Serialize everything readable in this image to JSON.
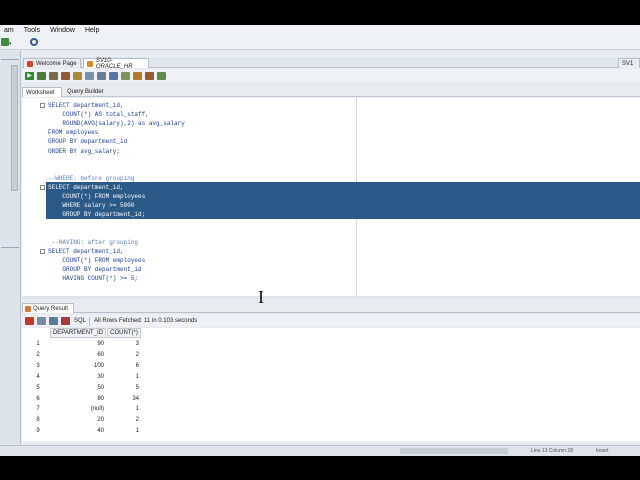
{
  "menu": [
    "am",
    "Tools",
    "Window",
    "Help"
  ],
  "tabs": [
    {
      "label": "Welcome Page",
      "active": false
    },
    {
      "label": "SV10-ORACLE_HR",
      "active": true
    }
  ],
  "right_tab": "SV1",
  "subtabs": [
    "Worksheet",
    "Query Builder"
  ],
  "code_lines": [
    {
      "text": "SELECT department_id,",
      "fold": true
    },
    {
      "text": "    COUNT(*) AS total_staff,",
      "fold": false
    },
    {
      "text": "    ROUND(AVG(salary),2) as avg_salary",
      "fold": false
    },
    {
      "text": "FROM employees",
      "fold": false
    },
    {
      "text": "GROUP BY department_id",
      "fold": false
    },
    {
      "text": "ORDER BY avg_salary;",
      "fold": false
    },
    {
      "text": "",
      "fold": false
    },
    {
      "text": "",
      "fold": false
    },
    {
      "text": "--WHERE: before grouping",
      "fold": false
    },
    {
      "text": "SELECT department_id,",
      "fold": true
    },
    {
      "text": "    COUNT(*) FROM employees",
      "fold": false
    },
    {
      "text": "    WHERE salary >= 5000",
      "fold": false
    },
    {
      "text": "    GROUP BY department_id;",
      "fold": false
    },
    {
      "text": "",
      "fold": false
    },
    {
      "text": "",
      "fold": false
    },
    {
      "text": " --HAVING: after grouping",
      "fold": false
    },
    {
      "text": "SELECT department_id,",
      "fold": true
    },
    {
      "text": "    COUNT(*) FROM employees",
      "fold": false
    },
    {
      "text": "    GROUP BY department_id",
      "fold": false
    },
    {
      "text": "    HAVING COUNT(*) >= 5;",
      "fold": false
    }
  ],
  "results": {
    "tab_label": "Query Result",
    "sql_label": "SQL",
    "status": "All Rows Fetched: 11 in 0.103 seconds",
    "columns": [
      "DEPARTMENT_ID",
      "COUNT(*)"
    ],
    "rows": [
      [
        "1",
        "90",
        "3"
      ],
      [
        "2",
        "60",
        "2"
      ],
      [
        "3",
        "100",
        "6"
      ],
      [
        "4",
        "30",
        "1"
      ],
      [
        "5",
        "50",
        "5"
      ],
      [
        "6",
        "80",
        "34"
      ],
      [
        "7",
        "(null)",
        "1"
      ],
      [
        "8",
        "20",
        "2"
      ],
      [
        "9",
        "40",
        "1"
      ]
    ]
  },
  "statusbar": {
    "position": "Line 13 Column 28",
    "mode": "Insert"
  },
  "colors": {
    "selection": "#2b5a88",
    "keyword": "#1d3c9c",
    "comment": "#5d7dbb"
  }
}
